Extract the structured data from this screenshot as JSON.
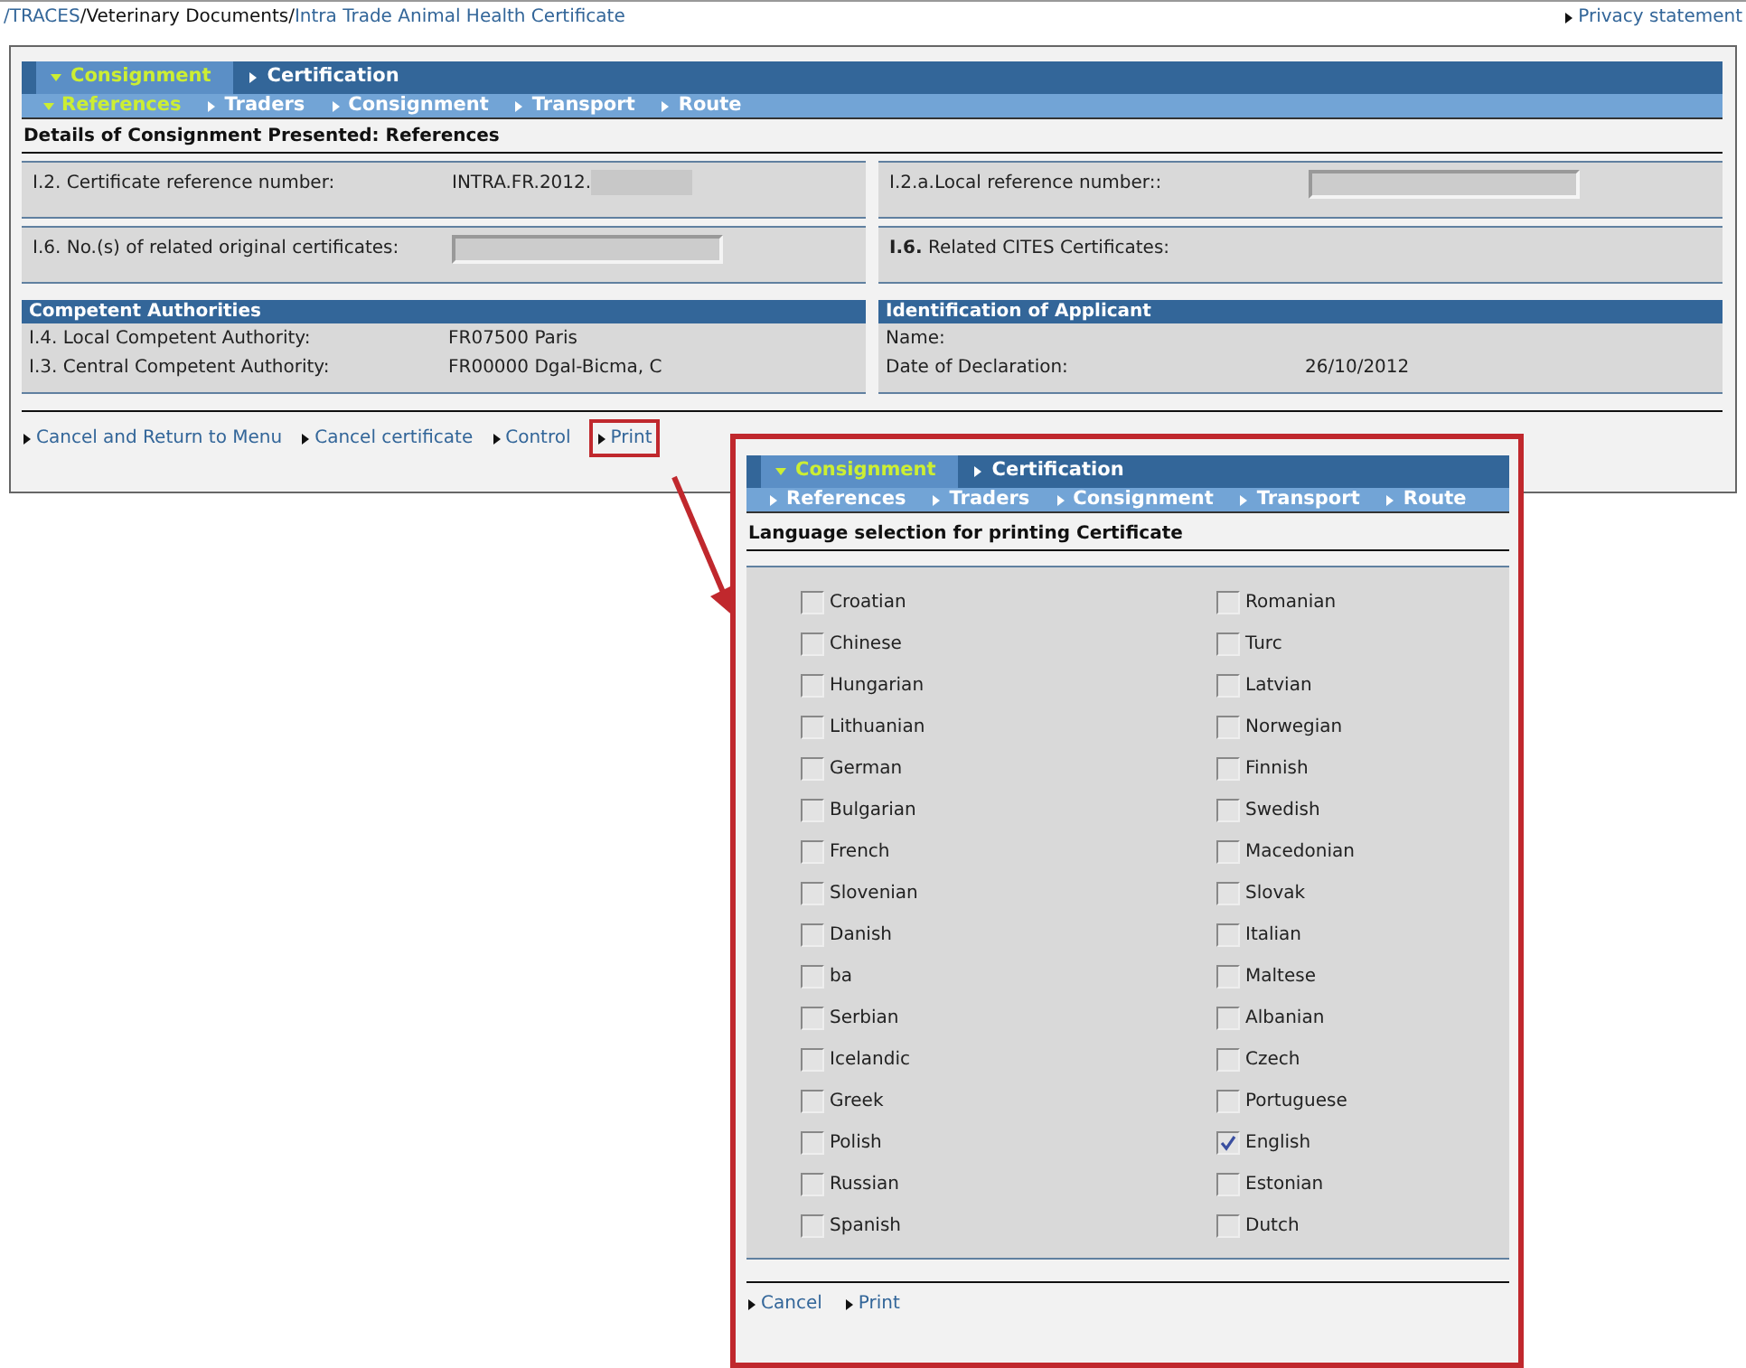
{
  "breadcrumb": [
    {
      "text": "/TRACES",
      "kind": "link"
    },
    {
      "text": "/Veterinary Documents/",
      "kind": "plain"
    },
    {
      "text": "Intra Trade Animal Health Certificate",
      "kind": "link"
    }
  ],
  "privacy_link": "Privacy statement",
  "main": {
    "tabs": [
      {
        "label": "Consignment",
        "selected": true
      },
      {
        "label": "Certification",
        "selected": false
      }
    ],
    "subtabs": [
      {
        "label": "References",
        "selected": true
      },
      {
        "label": "Traders",
        "selected": false
      },
      {
        "label": "Consignment",
        "selected": false
      },
      {
        "label": "Transport",
        "selected": false
      },
      {
        "label": "Route",
        "selected": false
      }
    ],
    "heading": "Details of Consignment Presented: References",
    "field_rows": [
      [
        {
          "label": "I.2. Certificate reference number:",
          "kind": "value",
          "value": "INTRA.FR.2012.",
          "redacted": true
        },
        {
          "label": "I.2.a.Local reference number::",
          "kind": "input"
        }
      ],
      [
        {
          "label": "I.6. No.(s) of related original certificates:",
          "kind": "input"
        },
        {
          "label": "**I.6.** Related CITES Certificates:",
          "kind": "none"
        }
      ]
    ],
    "sections": [
      {
        "title": "Competent Authorities",
        "rows": [
          {
            "label": "I.4. Local Competent Authority:",
            "value": "FR07500 Paris"
          },
          {
            "label": "I.3. Central Competent Authority:",
            "value": "FR00000 Dgal-Bicma, C"
          }
        ]
      },
      {
        "title": "Identification of Applicant",
        "rows": [
          {
            "label": "Name:"
          },
          {
            "label": "Date of Declaration:",
            "value": "26/10/2012"
          }
        ]
      }
    ],
    "actions": [
      {
        "label": "Cancel and Return to Menu",
        "highlighted": false
      },
      {
        "label": "Cancel certificate",
        "highlighted": false
      },
      {
        "label": "Control",
        "highlighted": false
      },
      {
        "label": "Print",
        "highlighted": true
      }
    ]
  },
  "print_dialog": {
    "tabs": [
      {
        "label": "Consignment",
        "selected": true
      },
      {
        "label": "Certification",
        "selected": false
      }
    ],
    "subtabs": [
      {
        "label": "References",
        "selected": false
      },
      {
        "label": "Traders",
        "selected": false
      },
      {
        "label": "Consignment",
        "selected": false
      },
      {
        "label": "Transport",
        "selected": false
      },
      {
        "label": "Route",
        "selected": false
      }
    ],
    "heading": "Language selection for printing Certificate",
    "language_columns": [
      [
        {
          "label": "Croatian",
          "checked": false
        },
        {
          "label": "Chinese",
          "checked": false
        },
        {
          "label": "Hungarian",
          "checked": false
        },
        {
          "label": "Lithuanian",
          "checked": false
        },
        {
          "label": "German",
          "checked": false
        },
        {
          "label": "Bulgarian",
          "checked": false
        },
        {
          "label": "French",
          "checked": false
        },
        {
          "label": "Slovenian",
          "checked": false
        },
        {
          "label": "Danish",
          "checked": false
        },
        {
          "label": "ba",
          "checked": false
        },
        {
          "label": "Serbian",
          "checked": false
        },
        {
          "label": "Icelandic",
          "checked": false
        },
        {
          "label": "Greek",
          "checked": false
        },
        {
          "label": "Polish",
          "checked": false
        },
        {
          "label": "Russian",
          "checked": false
        },
        {
          "label": "Spanish",
          "checked": false
        }
      ],
      [
        {
          "label": "Romanian",
          "checked": false
        },
        {
          "label": "Turc",
          "checked": false
        },
        {
          "label": "Latvian",
          "checked": false
        },
        {
          "label": "Norwegian",
          "checked": false
        },
        {
          "label": "Finnish",
          "checked": false
        },
        {
          "label": "Swedish",
          "checked": false
        },
        {
          "label": "Macedonian",
          "checked": false
        },
        {
          "label": "Slovak",
          "checked": false
        },
        {
          "label": "Italian",
          "checked": false
        },
        {
          "label": "Maltese",
          "checked": false
        },
        {
          "label": "Albanian",
          "checked": false
        },
        {
          "label": "Czech",
          "checked": false
        },
        {
          "label": "Portuguese",
          "checked": false
        },
        {
          "label": "English",
          "checked": true
        },
        {
          "label": "Estonian",
          "checked": false
        },
        {
          "label": "Dutch",
          "checked": false
        }
      ]
    ],
    "actions": [
      {
        "label": "Cancel",
        "highlighted": false
      },
      {
        "label": "Print",
        "highlighted": false
      }
    ]
  }
}
